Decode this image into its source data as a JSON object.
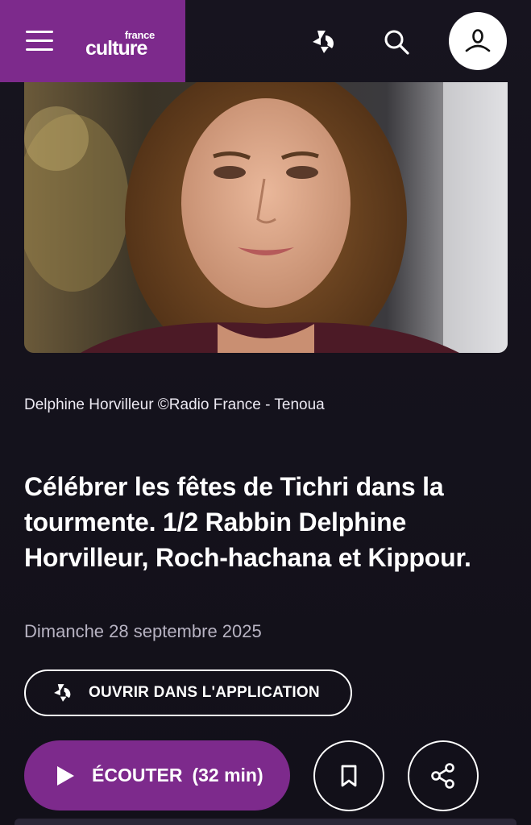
{
  "header": {
    "menu_icon": "hamburger-menu-icon",
    "brand_small": "france",
    "brand_big": "culture",
    "app_icon": "radio-france-app-icon",
    "search_icon": "search-icon",
    "account_icon": "user-account-icon",
    "brand_color": "#7d2a8c"
  },
  "article": {
    "image_caption": "Delphine Horvilleur ©Radio France - Tenoua",
    "title": "Célébrer les fêtes de Tichri dans la tourmente. 1/2 Rabbin Delphine Horvilleur, Roch-hachana et Kippour.",
    "date": "Dimanche 28 septembre 2025"
  },
  "actions": {
    "open_app_label": "OUVRIR DANS L'APPLICATION",
    "listen_label": "ÉCOUTER",
    "listen_duration": "(32 min)",
    "bookmark_icon": "bookmark-icon",
    "share_icon": "share-icon"
  }
}
